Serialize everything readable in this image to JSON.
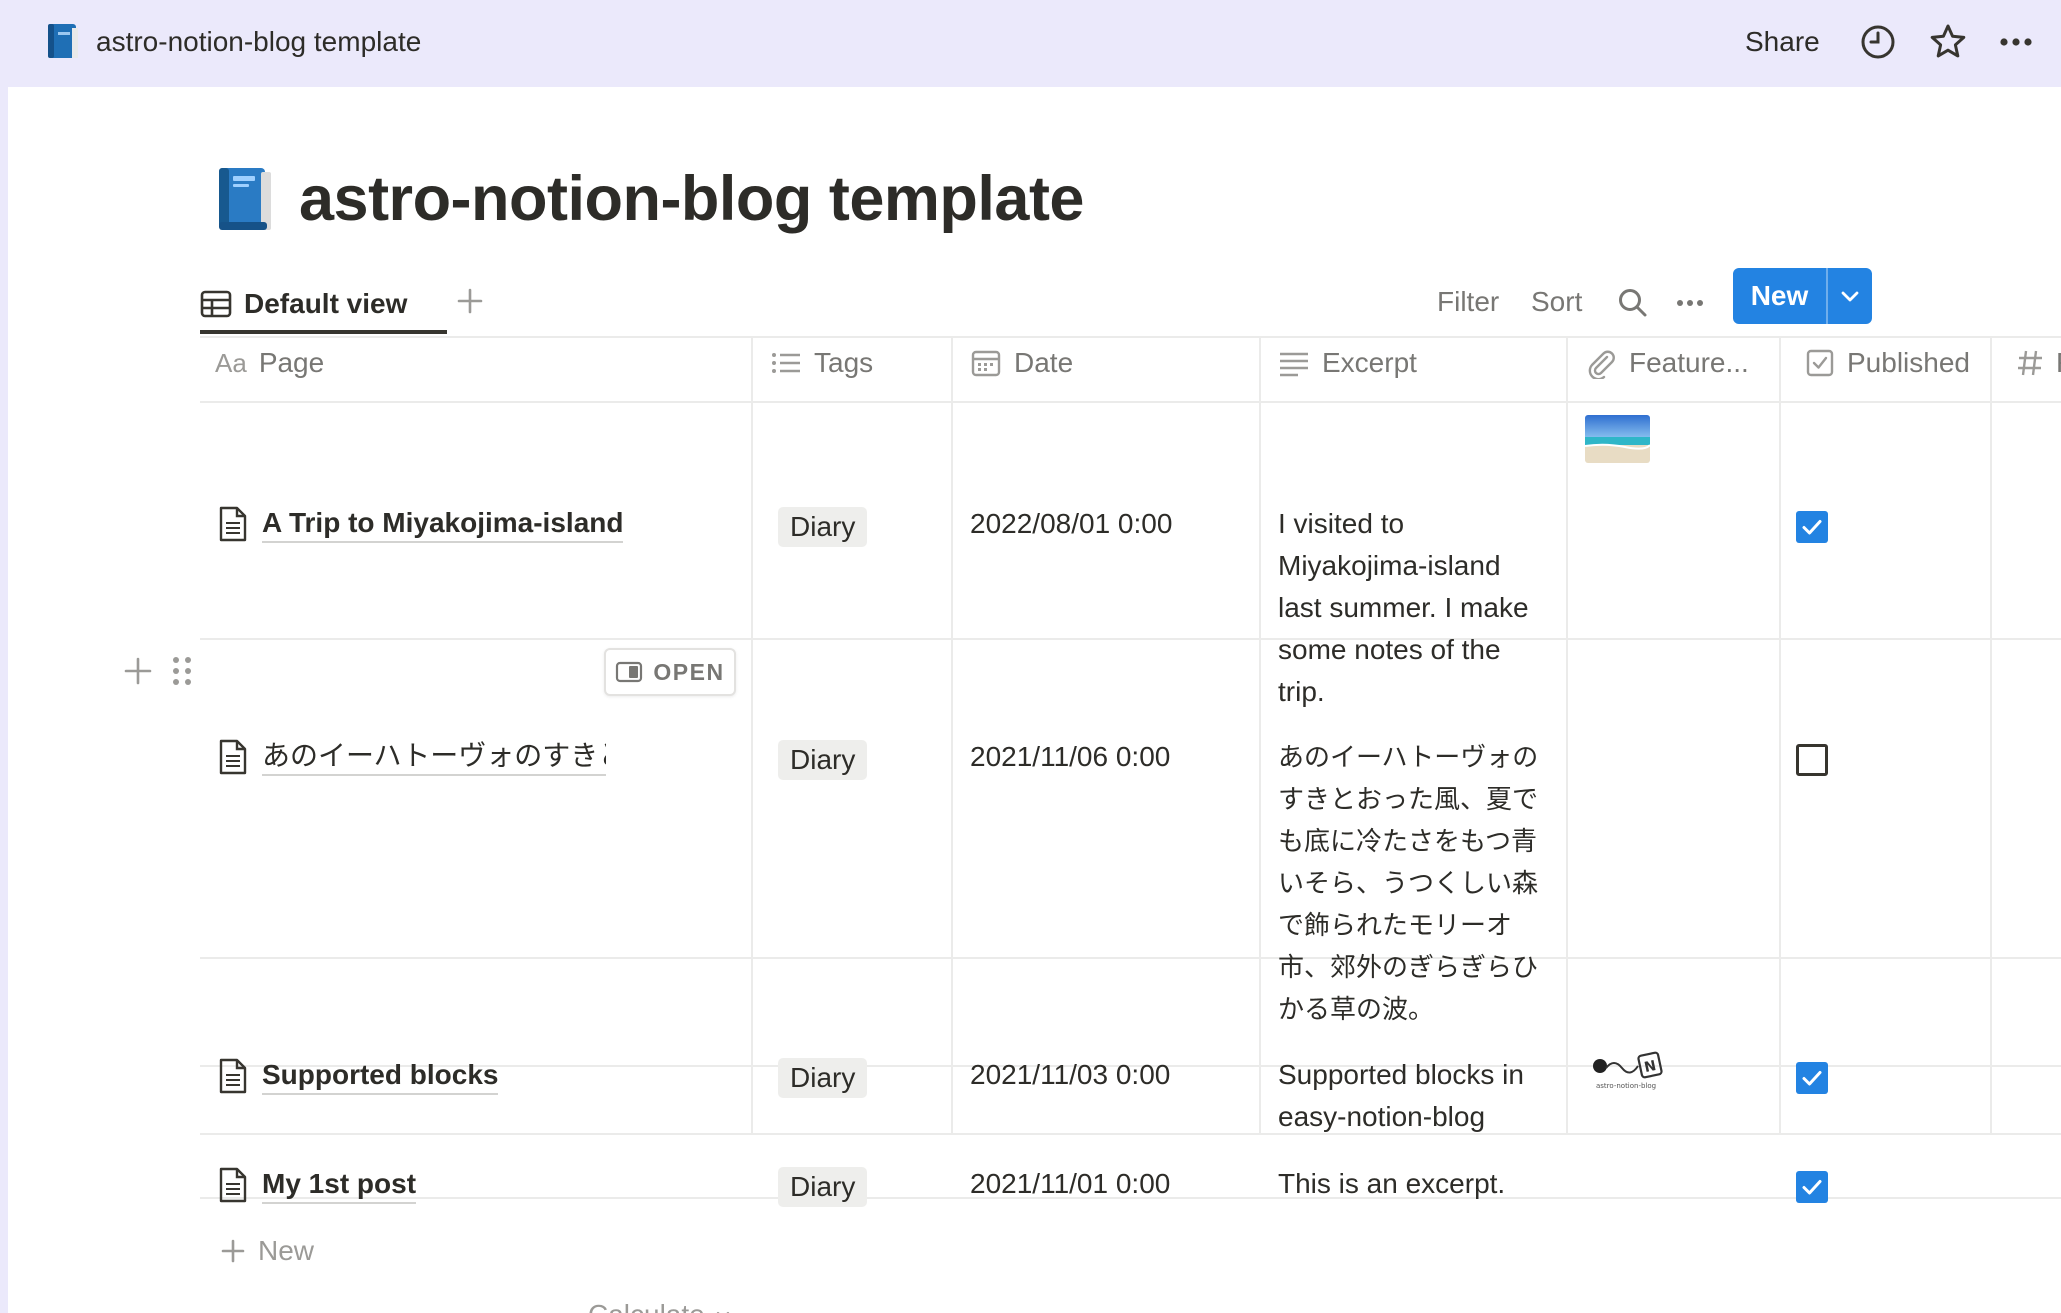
{
  "topbar": {
    "title": "astro-notion-blog template",
    "share_label": "Share",
    "icons": [
      "book-icon",
      "clock-icon",
      "star-icon",
      "more-icon"
    ]
  },
  "page": {
    "icon": "blue-book-icon",
    "title": "astro-notion-blog template"
  },
  "view": {
    "tab_label": "Default view",
    "filter_label": "Filter",
    "sort_label": "Sort",
    "new_label": "New"
  },
  "columns": [
    {
      "icon": "Aa",
      "label": "Page"
    },
    {
      "icon": "list-icon",
      "label": "Tags"
    },
    {
      "icon": "calendar-icon",
      "label": "Date"
    },
    {
      "icon": "text-icon",
      "label": "Excerpt"
    },
    {
      "icon": "paperclip-icon",
      "label": "Feature..."
    },
    {
      "icon": "checkbox-icon",
      "label": "Published"
    },
    {
      "icon": "hash-icon",
      "label": "R"
    }
  ],
  "rows": [
    {
      "title": "A Trip to Miyakojima-island",
      "tag": "Diary",
      "date": "2022/08/01 0:00",
      "excerpt_lines": [
        "I visited to",
        "Miyakojima-island",
        "last summer. I make",
        "some notes of the",
        "trip."
      ],
      "feature": "beach-photo",
      "published": true
    },
    {
      "title": "あのイーハトーヴォのすきと",
      "tag": "Diary",
      "date": "2021/11/06 0:00",
      "excerpt_lines": [
        "あのイーハトーヴォの",
        "すきとおった風、夏で",
        "も底に冷たさをもつ青",
        "いそら、うつくしい森",
        "で飾られたモリーオ",
        "市、郊外のぎらぎらひ",
        "かる草の波。"
      ],
      "feature": "",
      "published": false,
      "open_label": "OPEN"
    },
    {
      "title": "Supported blocks",
      "tag": "Diary",
      "date": "2021/11/03 0:00",
      "excerpt_lines": [
        "Supported blocks in",
        "easy-notion-blog"
      ],
      "feature": "astro-notion-blog-logo",
      "feature_caption": "astro-notion-blog",
      "published": true
    },
    {
      "title": "My 1st post",
      "tag": "Diary",
      "date": "2021/11/01 0:00",
      "excerpt_lines": [
        "This is an excerpt."
      ],
      "feature": "",
      "published": true
    }
  ],
  "footer": {
    "new_row_label": "New",
    "calculate_label": "Calculate"
  },
  "colors": {
    "accent": "#2383e2",
    "topbar_bg": "#ebe9fb",
    "text": "#37352f",
    "muted": "#787774"
  }
}
